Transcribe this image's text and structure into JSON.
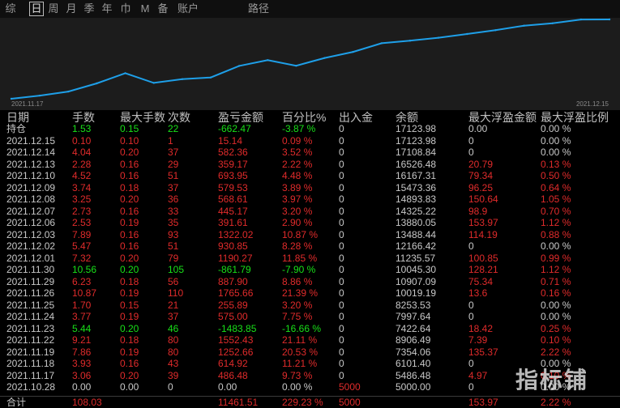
{
  "tabs": [
    {
      "label": "综",
      "active": false
    },
    {
      "label": "日",
      "active": true
    },
    {
      "label": "周",
      "active": false
    },
    {
      "label": "月",
      "active": false
    },
    {
      "label": "季",
      "active": false
    },
    {
      "label": "年",
      "active": false
    },
    {
      "label": "巾",
      "active": false
    },
    {
      "label": "M",
      "active": false
    },
    {
      "label": "备",
      "active": false
    },
    {
      "label": "账户",
      "active": false
    },
    {
      "label": "路径",
      "active": false
    }
  ],
  "chart_data": {
    "type": "line",
    "x_start_label": "2021.11.17",
    "x_end_label": "2021.12.15",
    "line_color": "#1e9fe8",
    "background": "#1c1c1c",
    "grid": false,
    "x": [
      "2021.10.28",
      "2021.11.17",
      "2021.11.18",
      "2021.11.19",
      "2021.11.22",
      "2021.11.23",
      "2021.11.24",
      "2021.11.25",
      "2021.11.26",
      "2021.11.29",
      "2021.11.30",
      "2021.12.01",
      "2021.12.02",
      "2021.12.03",
      "2021.12.06",
      "2021.12.07",
      "2021.12.08",
      "2021.12.09",
      "2021.12.10",
      "2021.12.13",
      "2021.12.14",
      "2021.12.15"
    ],
    "y": [
      5000.0,
      5486.48,
      6101.4,
      7354.06,
      8906.49,
      7422.64,
      7997.64,
      8253.53,
      10019.19,
      10907.09,
      10045.3,
      11235.57,
      12166.42,
      13488.44,
      13880.05,
      14325.22,
      14893.83,
      15473.36,
      16167.31,
      16526.48,
      17108.84,
      17123.98
    ]
  },
  "table": {
    "headers": [
      "日期",
      "手数",
      "最大手数",
      "次数",
      "盈亏金额",
      "百分比%",
      "出入金",
      "余额",
      "最大浮盈金额",
      "最大浮盈比例"
    ],
    "rows": [
      {
        "date": "持仓",
        "lots": "1.53",
        "max_lots": "0.15",
        "count": "22",
        "pnl": "-662.47",
        "pct": "-3.87 %",
        "io": "0",
        "balance": "17123.98",
        "mfe_amt": "0.00",
        "mfe_pct": "0.00 %",
        "color": "green",
        "mfe_color": "white"
      },
      {
        "date": "2021.12.15",
        "lots": "0.10",
        "max_lots": "0.10",
        "count": "1",
        "pnl": "15.14",
        "pct": "0.09 %",
        "io": "0",
        "balance": "17123.98",
        "mfe_amt": "0",
        "mfe_pct": "0.00 %",
        "color": "red",
        "mfe_color": "white"
      },
      {
        "date": "2021.12.14",
        "lots": "4.04",
        "max_lots": "0.20",
        "count": "37",
        "pnl": "582.36",
        "pct": "3.52 %",
        "io": "0",
        "balance": "17108.84",
        "mfe_amt": "0",
        "mfe_pct": "0.00 %",
        "color": "red",
        "mfe_color": "white"
      },
      {
        "date": "2021.12.13",
        "lots": "2.28",
        "max_lots": "0.16",
        "count": "29",
        "pnl": "359.17",
        "pct": "2.22 %",
        "io": "0",
        "balance": "16526.48",
        "mfe_amt": "20.79",
        "mfe_pct": "0.13 %",
        "color": "red",
        "mfe_color": "red"
      },
      {
        "date": "2021.12.10",
        "lots": "4.52",
        "max_lots": "0.16",
        "count": "51",
        "pnl": "693.95",
        "pct": "4.48 %",
        "io": "0",
        "balance": "16167.31",
        "mfe_amt": "79.34",
        "mfe_pct": "0.50 %",
        "color": "red",
        "mfe_color": "red"
      },
      {
        "date": "2021.12.09",
        "lots": "3.74",
        "max_lots": "0.18",
        "count": "37",
        "pnl": "579.53",
        "pct": "3.89 %",
        "io": "0",
        "balance": "15473.36",
        "mfe_amt": "96.25",
        "mfe_pct": "0.64 %",
        "color": "red",
        "mfe_color": "red"
      },
      {
        "date": "2021.12.08",
        "lots": "3.25",
        "max_lots": "0.20",
        "count": "36",
        "pnl": "568.61",
        "pct": "3.97 %",
        "io": "0",
        "balance": "14893.83",
        "mfe_amt": "150.64",
        "mfe_pct": "1.05 %",
        "color": "red",
        "mfe_color": "red"
      },
      {
        "date": "2021.12.07",
        "lots": "2.73",
        "max_lots": "0.16",
        "count": "33",
        "pnl": "445.17",
        "pct": "3.20 %",
        "io": "0",
        "balance": "14325.22",
        "mfe_amt": "98.9",
        "mfe_pct": "0.70 %",
        "color": "red",
        "mfe_color": "red"
      },
      {
        "date": "2021.12.06",
        "lots": "2.53",
        "max_lots": "0.19",
        "count": "35",
        "pnl": "391.61",
        "pct": "2.90 %",
        "io": "0",
        "balance": "13880.05",
        "mfe_amt": "153.97",
        "mfe_pct": "1.12 %",
        "color": "red",
        "mfe_color": "red"
      },
      {
        "date": "2021.12.03",
        "lots": "7.89",
        "max_lots": "0.16",
        "count": "93",
        "pnl": "1322.02",
        "pct": "10.87 %",
        "io": "0",
        "balance": "13488.44",
        "mfe_amt": "114.19",
        "mfe_pct": "0.88 %",
        "color": "red",
        "mfe_color": "red"
      },
      {
        "date": "2021.12.02",
        "lots": "5.47",
        "max_lots": "0.16",
        "count": "51",
        "pnl": "930.85",
        "pct": "8.28 %",
        "io": "0",
        "balance": "12166.42",
        "mfe_amt": "0",
        "mfe_pct": "0.00 %",
        "color": "red",
        "mfe_color": "white"
      },
      {
        "date": "2021.12.01",
        "lots": "7.32",
        "max_lots": "0.20",
        "count": "79",
        "pnl": "1190.27",
        "pct": "11.85 %",
        "io": "0",
        "balance": "11235.57",
        "mfe_amt": "100.85",
        "mfe_pct": "0.99 %",
        "color": "red",
        "mfe_color": "red"
      },
      {
        "date": "2021.11.30",
        "lots": "10.56",
        "max_lots": "0.20",
        "count": "105",
        "pnl": "-861.79",
        "pct": "-7.90 %",
        "io": "0",
        "balance": "10045.30",
        "mfe_amt": "128.21",
        "mfe_pct": "1.12 %",
        "color": "green",
        "mfe_color": "red"
      },
      {
        "date": "2021.11.29",
        "lots": "6.23",
        "max_lots": "0.18",
        "count": "56",
        "pnl": "887.90",
        "pct": "8.86 %",
        "io": "0",
        "balance": "10907.09",
        "mfe_amt": "75.34",
        "mfe_pct": "0.71 %",
        "color": "red",
        "mfe_color": "red"
      },
      {
        "date": "2021.11.26",
        "lots": "10.87",
        "max_lots": "0.19",
        "count": "110",
        "pnl": "1765.66",
        "pct": "21.39 %",
        "io": "0",
        "balance": "10019.19",
        "mfe_amt": "13.6",
        "mfe_pct": "0.16 %",
        "color": "red",
        "mfe_color": "red"
      },
      {
        "date": "2021.11.25",
        "lots": "1.70",
        "max_lots": "0.15",
        "count": "21",
        "pnl": "255.89",
        "pct": "3.20 %",
        "io": "0",
        "balance": "8253.53",
        "mfe_amt": "0",
        "mfe_pct": "0.00 %",
        "color": "red",
        "mfe_color": "white"
      },
      {
        "date": "2021.11.24",
        "lots": "3.77",
        "max_lots": "0.19",
        "count": "37",
        "pnl": "575.00",
        "pct": "7.75 %",
        "io": "0",
        "balance": "7997.64",
        "mfe_amt": "0",
        "mfe_pct": "0.00 %",
        "color": "red",
        "mfe_color": "white"
      },
      {
        "date": "2021.11.23",
        "lots": "5.44",
        "max_lots": "0.20",
        "count": "46",
        "pnl": "-1483.85",
        "pct": "-16.66 %",
        "io": "0",
        "balance": "7422.64",
        "mfe_amt": "18.42",
        "mfe_pct": "0.25 %",
        "color": "green",
        "mfe_color": "red"
      },
      {
        "date": "2021.11.22",
        "lots": "9.21",
        "max_lots": "0.18",
        "count": "80",
        "pnl": "1552.43",
        "pct": "21.11 %",
        "io": "0",
        "balance": "8906.49",
        "mfe_amt": "7.39",
        "mfe_pct": "0.10 %",
        "color": "red",
        "mfe_color": "red"
      },
      {
        "date": "2021.11.19",
        "lots": "7.86",
        "max_lots": "0.19",
        "count": "80",
        "pnl": "1252.66",
        "pct": "20.53 %",
        "io": "0",
        "balance": "7354.06",
        "mfe_amt": "135.37",
        "mfe_pct": "2.22 %",
        "color": "red",
        "mfe_color": "red"
      },
      {
        "date": "2021.11.18",
        "lots": "3.93",
        "max_lots": "0.16",
        "count": "43",
        "pnl": "614.92",
        "pct": "11.21 %",
        "io": "0",
        "balance": "6101.40",
        "mfe_amt": "0",
        "mfe_pct": "0.00 %",
        "color": "red",
        "mfe_color": "white"
      },
      {
        "date": "2021.11.17",
        "lots": "3.06",
        "max_lots": "0.20",
        "count": "39",
        "pnl": "486.48",
        "pct": "9.73 %",
        "io": "0",
        "balance": "5486.48",
        "mfe_amt": "4.97",
        "mfe_pct": "0.10 %",
        "color": "red",
        "mfe_color": "red"
      },
      {
        "date": "2021.10.28",
        "lots": "0.00",
        "max_lots": "0.00",
        "count": "0",
        "pnl": "0.00",
        "pct": "0.00 %",
        "io": "5000",
        "balance": "5000.00",
        "mfe_amt": "0",
        "mfe_pct": "0.00 %",
        "color": "white",
        "mfe_color": "white",
        "io_color": "red"
      }
    ],
    "total": {
      "date": "合计",
      "lots": "108.03",
      "max_lots": "",
      "count": "",
      "pnl": "11461.51",
      "pct": "229.23 %",
      "io": "5000",
      "balance": "",
      "mfe_amt": "153.97",
      "mfe_pct": "2.22 %",
      "color": "red",
      "mfe_color": "red",
      "io_color": "red"
    }
  },
  "watermark": "指标铺"
}
